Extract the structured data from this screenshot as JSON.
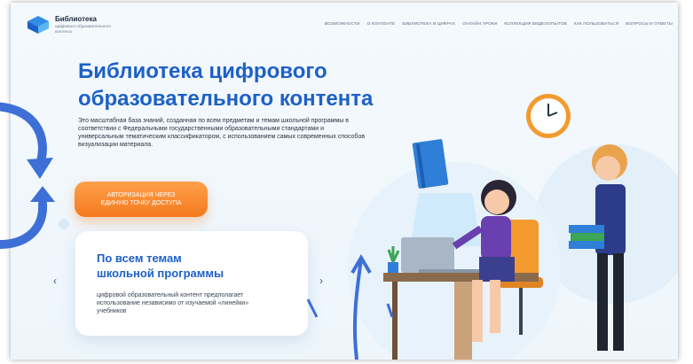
{
  "brand": {
    "title": "Библиотека",
    "subtitle": "цифрового образовательного контента"
  },
  "nav": {
    "items": [
      "ВОЗМОЖНОСТИ",
      "О КОНТЕНТЕ",
      "БИБЛИОТЕКА В ЦИФРАХ",
      "ОНЛАЙН УРОКИ",
      "КОЛЛЕКЦИЯ ВИДЕООПЫТОВ",
      "КАК ПОЛЬЗОВАТЬСЯ",
      "ВОПРОСЫ И ОТВЕТЫ"
    ]
  },
  "hero": {
    "title_line1": "Библиотека цифрового",
    "title_line2": "образовательного контента",
    "description": "Это масштабная база знаний, созданная по всем предметам и темам школьной программы в соответствии с Федеральными государственными образовательными стандартами и универсальным тематическим классификатором, с использованием самых современных способов визуализации материала.",
    "cta_line1": "АВТОРИЗАЦИЯ ЧЕРЕЗ",
    "cta_line2": "ЕДИНУЮ ТОЧКУ ДОСТУПА"
  },
  "slider": {
    "card_title_line1": "По всем темам",
    "card_title_line2": "школьной программы",
    "card_text": "цифровой образовательный контент предполагает использование независимо от изучаемой «линейки» учебников",
    "prev": "‹",
    "next": "›"
  },
  "colors": {
    "accent": "#1d60c8",
    "cta": "#f47a1e",
    "annotation": "#3d6fd6"
  }
}
